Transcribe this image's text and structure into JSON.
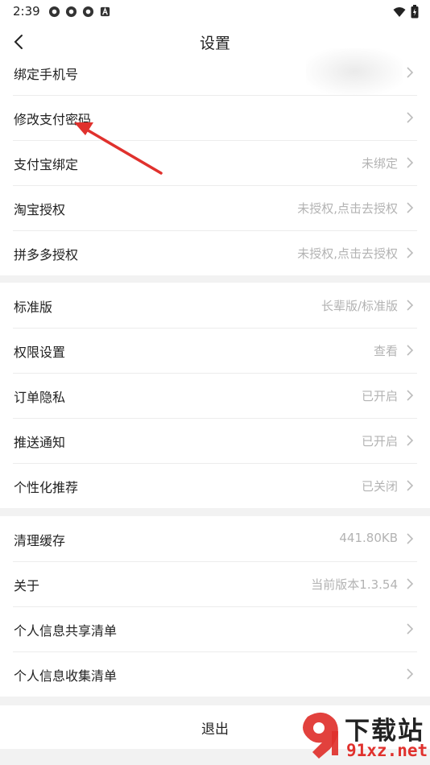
{
  "status_bar": {
    "time": "2:39",
    "icons": [
      "app-icon",
      "app-icon",
      "app-icon",
      "a-icon"
    ],
    "right_icons": [
      "wifi-icon",
      "battery-icon"
    ]
  },
  "nav": {
    "title": "设置",
    "back_icon": "chevron-left-icon"
  },
  "groups": [
    {
      "items": [
        {
          "label": "绑定手机号",
          "value": ""
        },
        {
          "label": "修改支付密码",
          "value": ""
        },
        {
          "label": "支付宝绑定",
          "value": "未绑定"
        },
        {
          "label": "淘宝授权",
          "value": "未授权,点击去授权"
        },
        {
          "label": "拼多多授权",
          "value": "未授权,点击去授权"
        }
      ]
    },
    {
      "items": [
        {
          "label": "标准版",
          "value": "长辈版/标准版"
        },
        {
          "label": "权限设置",
          "value": "查看"
        },
        {
          "label": "订单隐私",
          "value": "已开启"
        },
        {
          "label": "推送通知",
          "value": "已开启"
        },
        {
          "label": "个性化推荐",
          "value": "已关闭"
        }
      ]
    },
    {
      "items": [
        {
          "label": "清理缓存",
          "value": "441.80KB"
        },
        {
          "label": "关于",
          "value": "当前版本1.3.54"
        },
        {
          "label": "个人信息共享清单",
          "value": ""
        },
        {
          "label": "个人信息收集清单",
          "value": ""
        }
      ]
    }
  ],
  "logout": {
    "label": "退出"
  },
  "watermark": {
    "line1": "下载站",
    "line2": "91xz.net"
  },
  "colors": {
    "annotation_arrow": "#e0312d",
    "value_text": "#b3b3b3",
    "divider": "#ececec"
  }
}
